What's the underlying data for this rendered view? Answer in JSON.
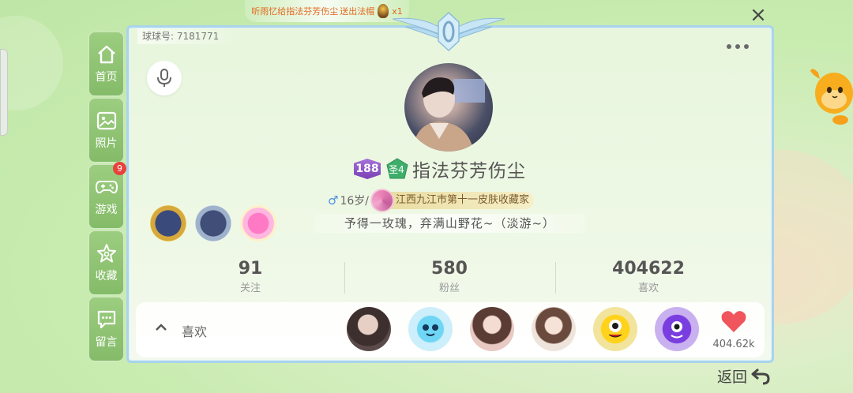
{
  "ticker": {
    "text": "听雨忆给指法芬芳伤尘",
    "gift_text": "送出法帽",
    "count": "x1"
  },
  "close_label": "×",
  "nav": [
    {
      "label": "首页",
      "icon": "home-icon"
    },
    {
      "label": "照片",
      "icon": "photo-icon"
    },
    {
      "label": "游戏",
      "icon": "gamepad-icon",
      "badge": "9"
    },
    {
      "label": "收藏",
      "icon": "star-icon"
    },
    {
      "label": "留言",
      "icon": "message-icon"
    }
  ],
  "profile": {
    "user_id_label": "球球号: 7181771",
    "level": "188",
    "rank_badge": "圣4",
    "username": "指法芬芳伤尘",
    "gender_symbol": "♂",
    "age": "16岁/",
    "title": "江西九江市第十一皮肤收藏家",
    "signature": "予得一玫瑰，弃满山野花~（淡游~）"
  },
  "stats": [
    {
      "value": "91",
      "label": "关注"
    },
    {
      "value": "580",
      "label": "粉丝"
    },
    {
      "value": "404622",
      "label": "喜欢"
    }
  ],
  "likes": {
    "label": "喜欢",
    "count": "404.62k"
  },
  "back_label": "返回",
  "colors": {
    "accent_green": "#8cc470",
    "heart": "#f0545c",
    "border_blue": "#a9d4ec"
  }
}
